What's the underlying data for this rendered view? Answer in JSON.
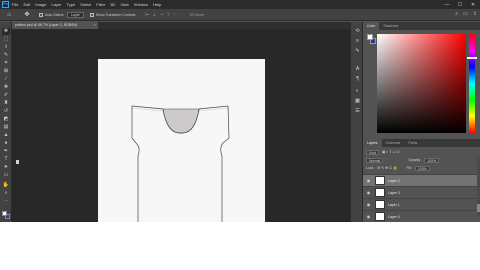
{
  "app": {
    "logo": "Ps"
  },
  "menu": [
    "File",
    "Edit",
    "Image",
    "Layer",
    "Type",
    "Select",
    "Filter",
    "3D",
    "View",
    "Window",
    "Help"
  ],
  "window_controls": [
    "—",
    "☐",
    "✕"
  ],
  "options_bar": {
    "home_icon": "home-icon",
    "move_icon": "move-tool-icon",
    "auto_select_label": "Auto-Select:",
    "auto_select_value": "Layer",
    "transform_controls_label": "Show Transform Controls",
    "mode_3d_label": "3D Mode:"
  },
  "document_tab": {
    "title": "pattern.psd @ 66.7% (Layer 2, RGB/8#)",
    "close": "×"
  },
  "toolbar": {
    "tools": [
      "move-tool-icon",
      "marquee-tool-icon",
      "lasso-tool-icon",
      "quick-select-tool-icon",
      "crop-tool-icon",
      "frame-tool-icon",
      "eyedropper-tool-icon",
      "healing-brush-icon",
      "brush-tool-icon",
      "clone-stamp-icon",
      "history-brush-icon",
      "eraser-tool-icon",
      "gradient-tool-icon",
      "blur-tool-icon",
      "dodge-tool-icon",
      "pen-tool-icon",
      "type-tool-icon",
      "path-select-icon",
      "shape-tool-icon",
      "hand-tool-icon",
      "zoom-tool-icon",
      "more-tools-icon"
    ],
    "foreground_color": "#ffffff",
    "background_color": "#1b3f9e"
  },
  "icon_strip": [
    "history-icon",
    "properties-icon",
    "brush-settings-icon",
    "character-icon",
    "paragraph-icon",
    "adjustments-icon",
    "swatches-icon",
    "libraries-icon"
  ],
  "color_panel": {
    "tabs": [
      "Color",
      "Swatches"
    ],
    "active_tab": 0,
    "hue_color": "#ff0000"
  },
  "layers_panel": {
    "tabs": [
      "Layers",
      "Channels",
      "Paths"
    ],
    "active_tab": 0,
    "filter_label": "Kind",
    "blend_mode": "Normal",
    "opacity_label": "Opacity:",
    "opacity_value": "100%",
    "lock_label": "Lock:",
    "fill_label": "Fill:",
    "fill_value": "100%",
    "layers": [
      {
        "name": "Layer 2",
        "selected": true,
        "visible": true
      },
      {
        "name": "Layer 3",
        "selected": false,
        "visible": true
      },
      {
        "name": "Layer 1",
        "selected": false,
        "visible": true
      },
      {
        "name": "Layer 0",
        "selected": false,
        "visible": true
      }
    ]
  },
  "artwork": {
    "subject": "t-shirt-pattern",
    "neck_fill": "#cccaca",
    "line_color": "#444444"
  }
}
